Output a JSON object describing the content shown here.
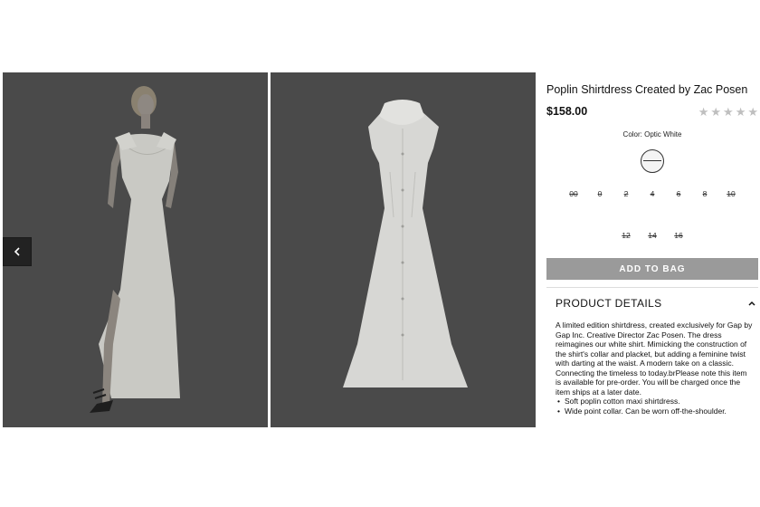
{
  "product": {
    "title": "Poplin Shirtdress Created by Zac Posen",
    "price": "$158.00",
    "rating": 0,
    "rating_max": 5,
    "color_label": "Color: Optic White",
    "sizes_row1": [
      "00",
      "0",
      "2",
      "4",
      "6",
      "8",
      "10"
    ],
    "sizes_row2": [
      "12",
      "14",
      "16"
    ],
    "add_to_bag": "ADD TO BAG",
    "details_title": "PRODUCT DETAILS",
    "description": "A limited edition shirtdress, created exclusively for Gap by Gap Inc. Creative Director Zac Posen. The dress reimagines our white shirt. Mimicking the construction of the shirt's collar and placket, but adding a feminine twist with darting at the waist. A modern take on a classic. Connecting the timeless to today.brPlease note this item is available for pre-order. You will be charged once the item ships at a later date.",
    "bullets": [
      "Soft poplin cotton maxi shirtdress.",
      "Wide point collar. Can be worn off-the-shoulder."
    ]
  },
  "colors": {
    "photo_bg": "#4a4a4a",
    "button_bg": "#9a9a9a",
    "star": "#bfbfbf"
  },
  "icons": {
    "prev": "chevron-left-icon",
    "collapse": "chevron-up-icon"
  }
}
